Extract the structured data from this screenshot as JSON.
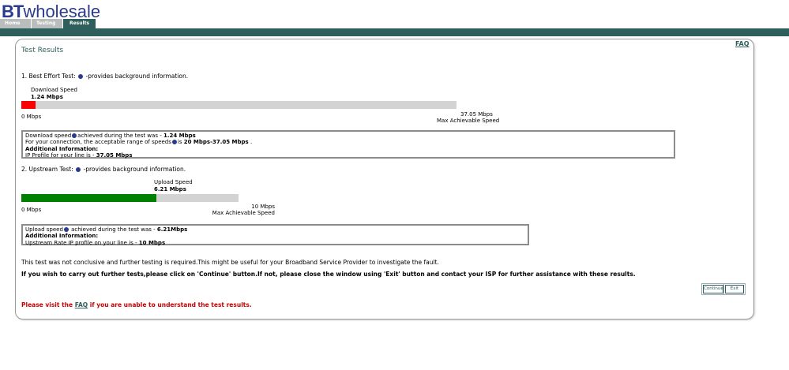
{
  "header": {
    "logo_bt": "BT",
    "logo_wholesale": "wholesale",
    "tabs": [
      {
        "label": "Home"
      },
      {
        "label": "Testing"
      },
      {
        "label": "Results"
      }
    ],
    "faq_link": "FAQ"
  },
  "results": {
    "title": "Test Results",
    "download": {
      "heading_prefix": "1. Best Effort Test:",
      "heading_suffix": "-provides background information.",
      "speed_label": "Download Speed",
      "speed_value": "1.24 Mbps",
      "fill_fraction": 0.0335,
      "fill_color": "#ff0000",
      "min_label": "0 Mbps",
      "max_value": "37.05 Mbps",
      "max_label": "Max Achievable Speed",
      "info": {
        "line1_prefix": "Download speed",
        "line1_mid": "achieved during the test was - ",
        "line1_value": "1.24 Mbps",
        "line2_prefix": "For your connection, the acceptable range of speeds",
        "line2_mid": "is ",
        "line2_value": "20 Mbps-37.05 Mbps",
        "line2_suffix": " .",
        "additional": "Additional Information:",
        "line3_prefix": "IP Profile for your line is - ",
        "line3_value": "37.05 Mbps"
      }
    },
    "upload": {
      "heading_prefix": "2. Upstream Test:",
      "heading_suffix": "-provides background information.",
      "speed_label": "Upload Speed",
      "speed_value": "6.21 Mbps",
      "fill_fraction": 0.621,
      "fill_color": "#008000",
      "min_label": "0 Mbps",
      "max_value": "10 Mbps",
      "max_label": "Max Achievable Speed",
      "info": {
        "line1_prefix": "Upload speed",
        "line1_mid": " achieved during the test was - ",
        "line1_value": "6.21Mbps",
        "additional": "Additional Information:",
        "line2_prefix": "Upstream Rate IP profile on your line is - ",
        "line2_value": "10 Mbps"
      }
    },
    "note": "This test was not conclusive and further testing is required.This might be useful for your Broadband Service Provider to investigate the fault.",
    "instruction": "If you wish to carry out further tests,please click on 'Continue' button.If not, please close the window using 'Exit' button and contact your ISP for further assistance with these results.",
    "continue_button": "Continue",
    "exit_button": "Exit",
    "footer_prefix": "Please visit the ",
    "footer_link": "FAQ",
    "footer_suffix": " if you are unable to understand the test results."
  }
}
